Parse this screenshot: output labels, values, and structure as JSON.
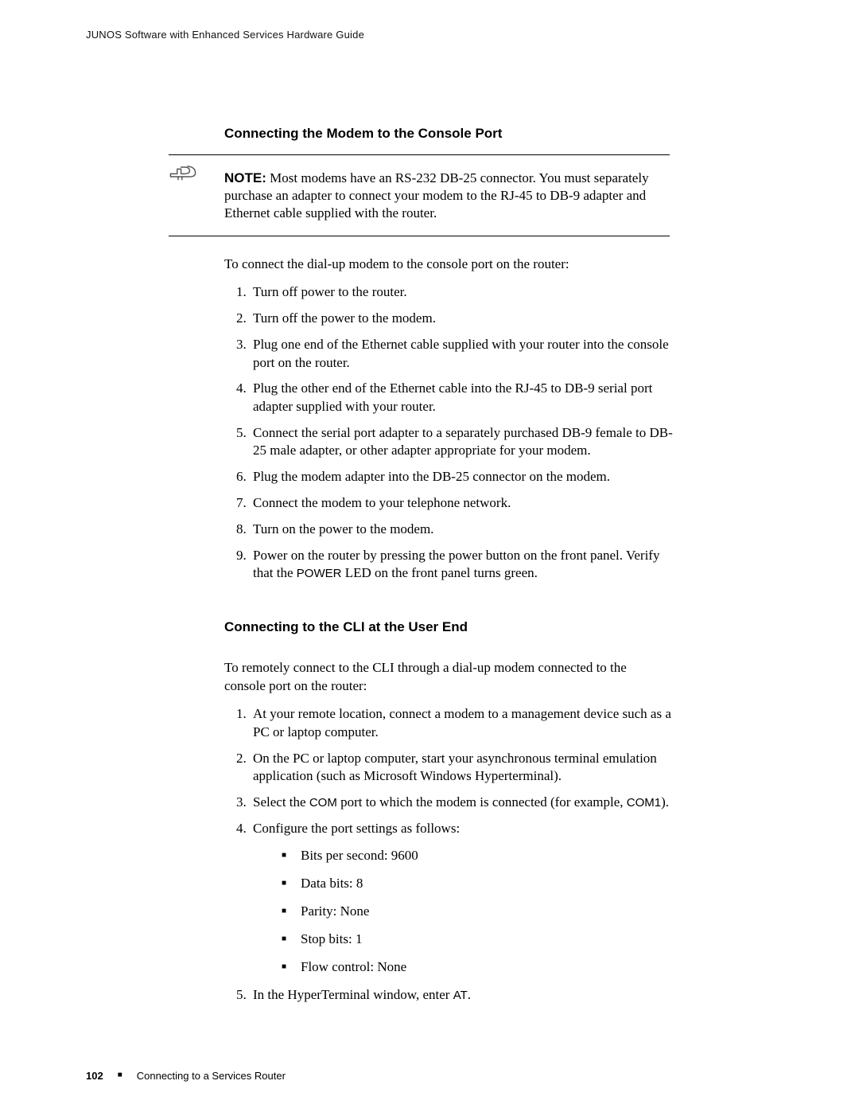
{
  "header": "JUNOS Software with Enhanced Services Hardware Guide",
  "section1": {
    "heading": "Connecting the Modem to the Console Port",
    "noteLabel": "NOTE:",
    "noteBody": " Most modems have an RS-232 DB-25 connector. You must separately purchase an adapter to connect your modem to the RJ-45 to DB-9 adapter and Ethernet cable supplied with the router.",
    "intro": "To connect the dial-up modem to the console port on the router:",
    "steps": [
      "Turn off power to the router.",
      "Turn off the power to the modem.",
      "Plug one end of the Ethernet cable supplied with your router into the console port on the router.",
      "Plug the other end of the Ethernet cable into the RJ-45 to DB-9 serial port adapter supplied with your router.",
      "Connect the serial port adapter to a separately purchased DB-9 female to DB-25 male adapter, or other adapter appropriate for your modem.",
      "Plug the modem adapter into the DB-25 connector on the modem.",
      "Connect the modem to your telephone network.",
      "Turn on the power to the modem."
    ],
    "step9_a": "Power on the router by pressing the power button on the front panel. Verify that the ",
    "step9_led": "POWER",
    "step9_b": " LED on the front panel turns green."
  },
  "section2": {
    "heading": "Connecting to the CLI at the User End",
    "intro": "To remotely connect to the CLI through a dial-up modem connected to the console port on the router:",
    "step1": "At your remote location, connect a modem to a management device such as a PC or laptop computer.",
    "step2": "On the PC or laptop computer, start your asynchronous terminal emulation application (such as Microsoft Windows Hyperterminal).",
    "step3_a": "Select the ",
    "step3_com": "COM",
    "step3_b": " port to which the modem is connected (for example, ",
    "step3_com1": "COM1",
    "step3_c": ").",
    "step4_label": "Configure the port settings as follows:",
    "settings": [
      "Bits per second: 9600",
      "Data bits: 8",
      "Parity: None",
      "Stop bits: 1",
      "Flow control: None"
    ],
    "step5_a": "In the HyperTerminal window, enter ",
    "step5_at": "AT",
    "step5_b": "."
  },
  "footer": {
    "pageNumber": "102",
    "sectionTitle": "Connecting to a Services Router"
  }
}
